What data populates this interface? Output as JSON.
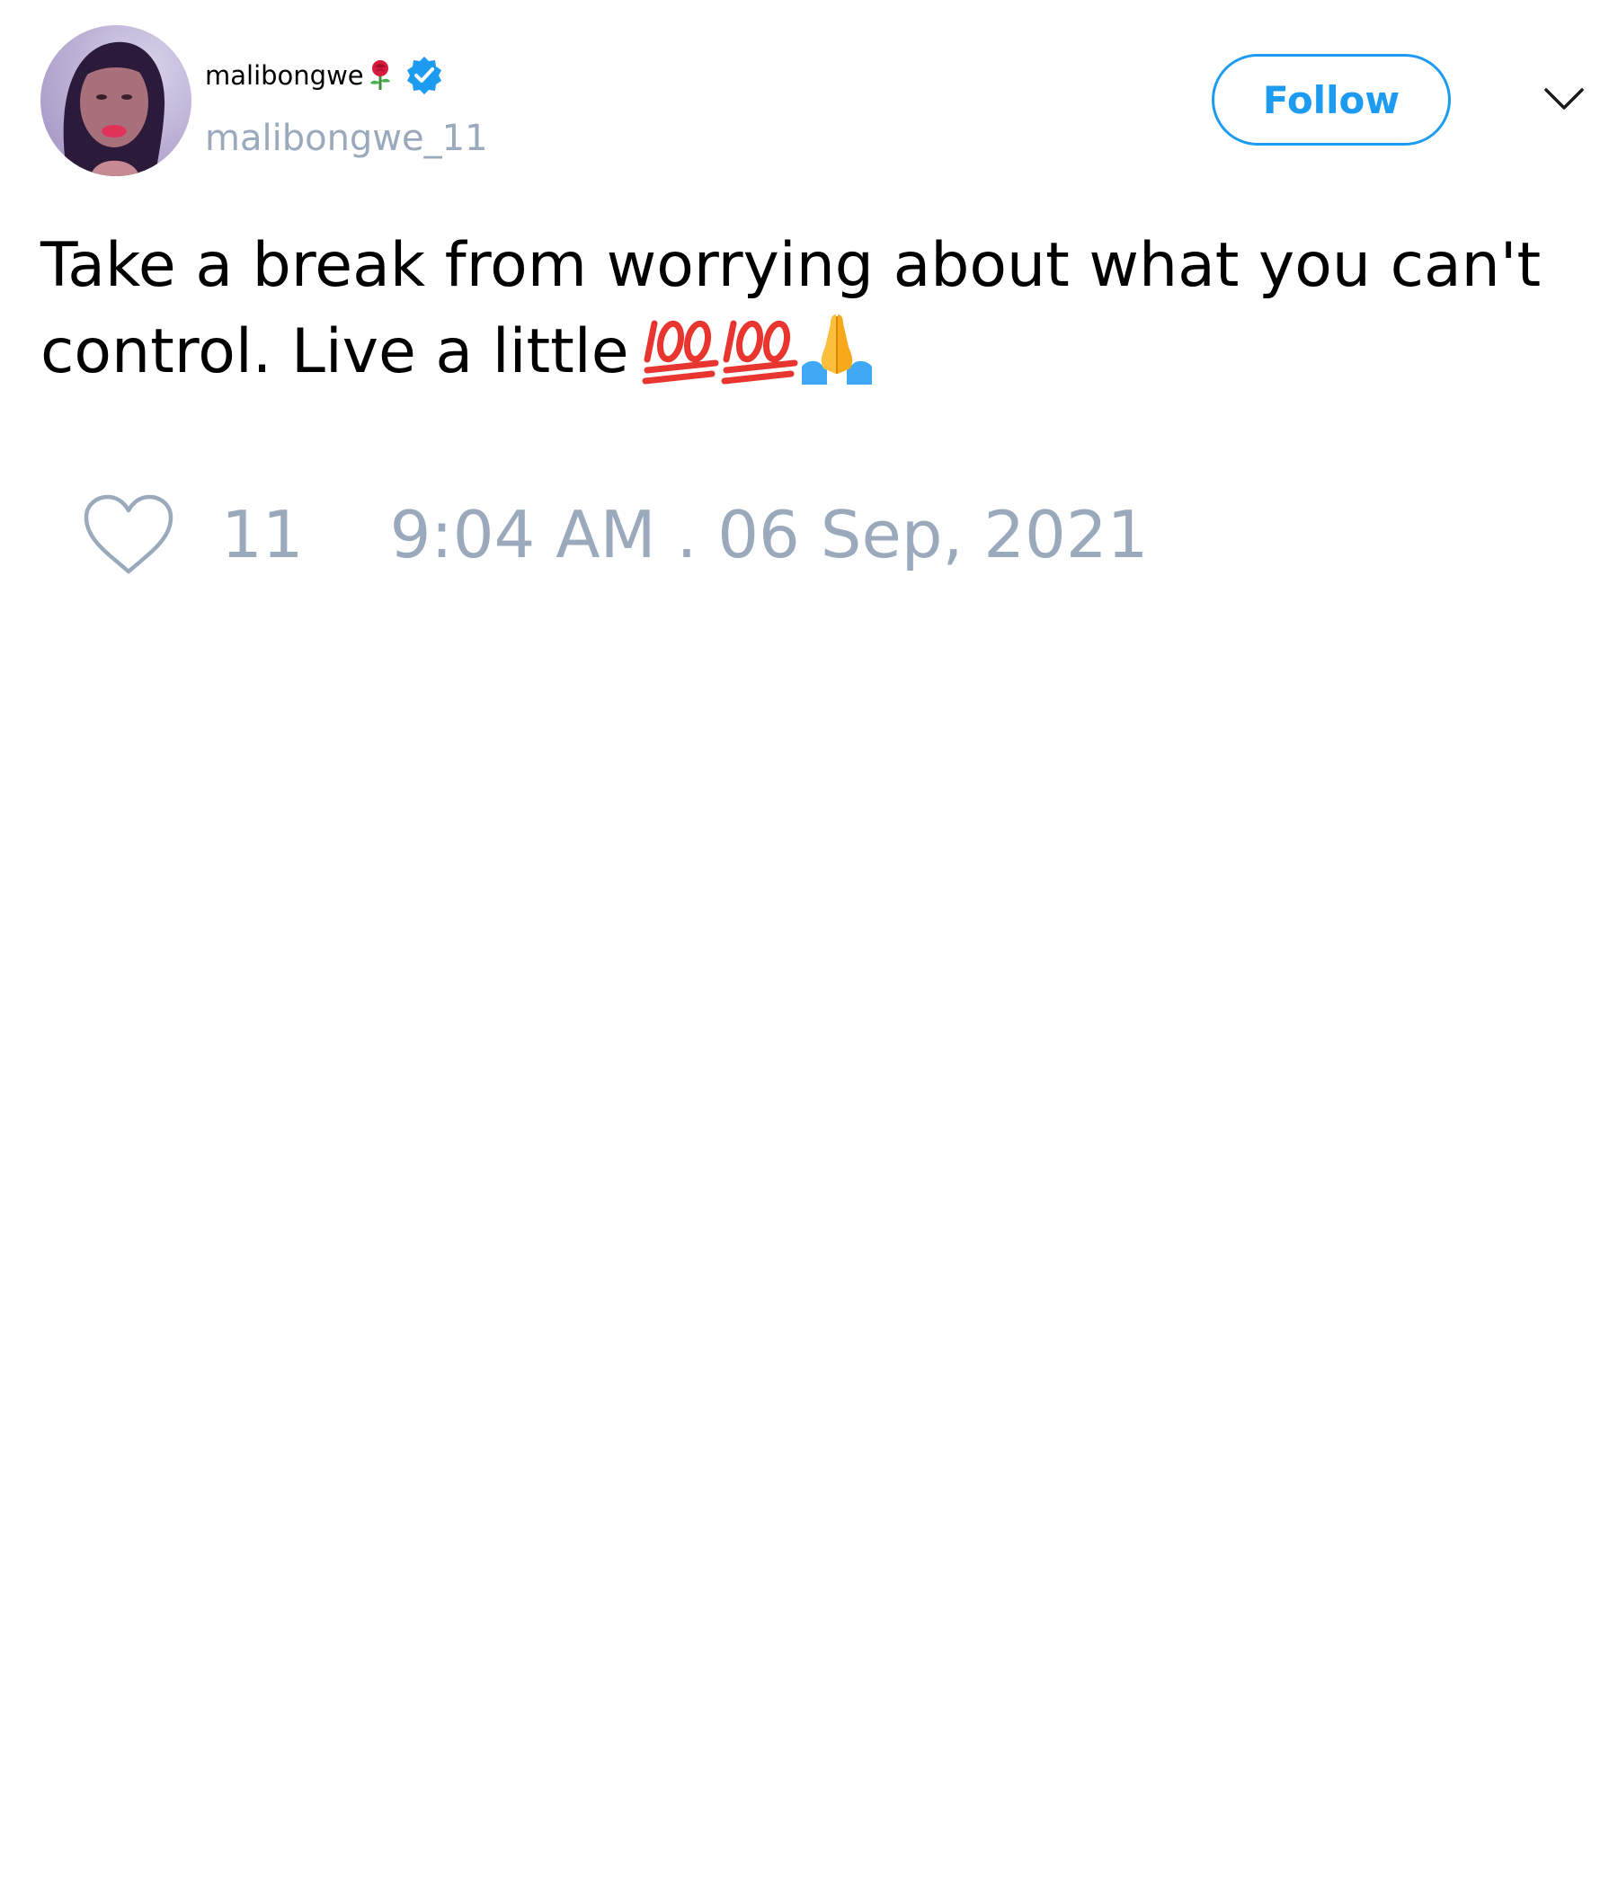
{
  "author": {
    "display_name": "malibongwe",
    "name_emoji_icon": "rose-icon",
    "verified_icon": "verified-badge-icon",
    "handle": "malibongwe_11",
    "avatar_icon": "avatar-photo"
  },
  "header": {
    "follow_label": "Follow",
    "menu_icon": "chevron-down-icon"
  },
  "tweet": {
    "text": "Take a break from worrying about what you can't control. Live a little",
    "emojis": [
      "hundred-points-icon",
      "hundred-points-icon",
      "folded-hands-icon"
    ]
  },
  "footer": {
    "like_icon": "heart-icon",
    "like_count": "11",
    "timestamp": "9:04 AM . 06 Sep, 2021"
  },
  "colors": {
    "accent": "#1d9bf0",
    "muted": "#9aa9bb",
    "text": "#000000",
    "background": "#ffffff"
  }
}
